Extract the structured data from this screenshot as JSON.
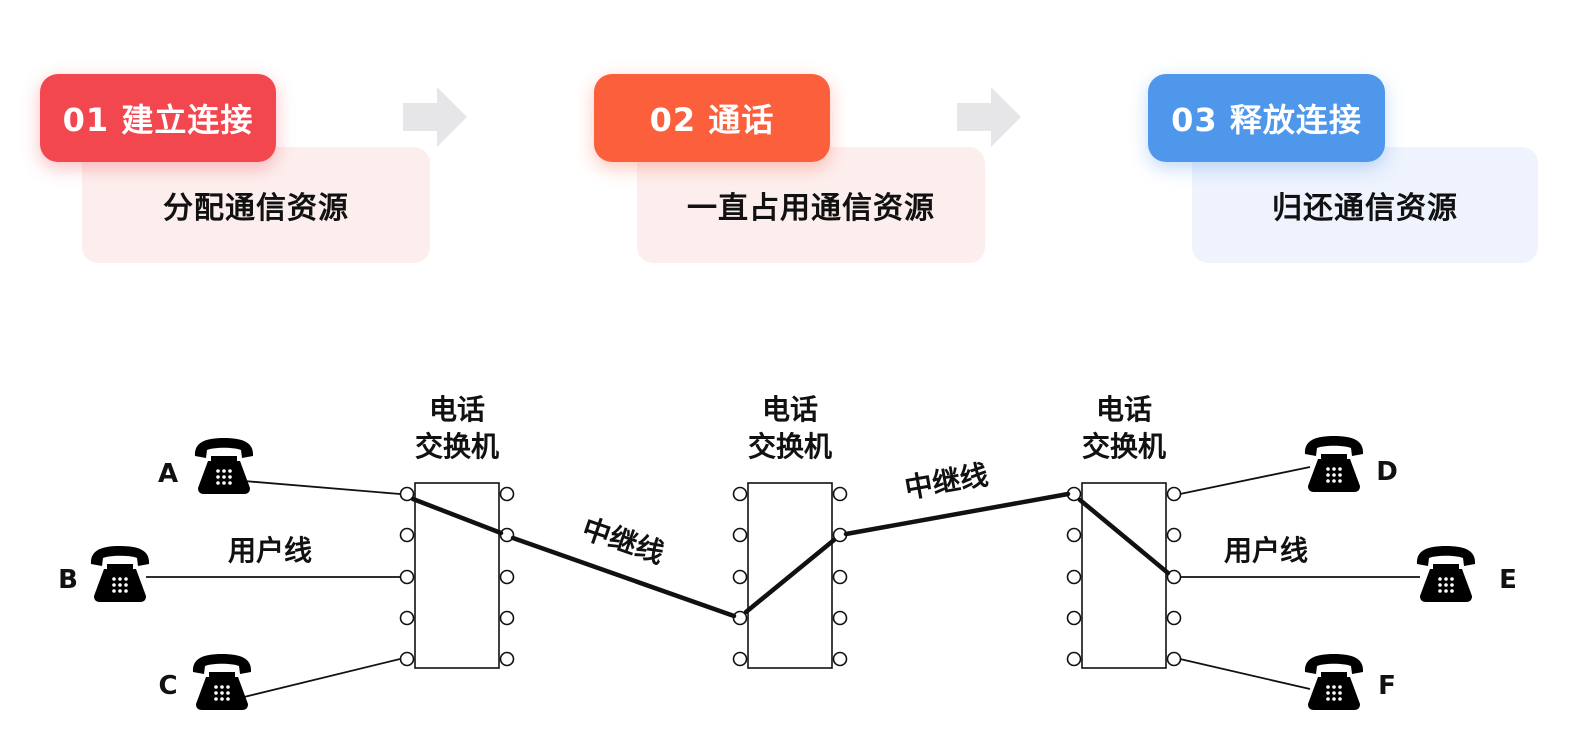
{
  "steps": [
    {
      "title": "01 建立连接",
      "desc": "分配通信资源",
      "color": "#f2474f",
      "desc_bg": "#fdeeee"
    },
    {
      "title": "02 通话",
      "desc": "一直占用通信资源",
      "color": "#fb5f3c",
      "desc_bg": "#fdeeee"
    },
    {
      "title": "03 释放连接",
      "desc": "归还通信资源",
      "color": "#4f97ea",
      "desc_bg": "#eef3fd"
    }
  ],
  "diagram": {
    "switch_label_line1": "电话",
    "switch_label_line2": "交换机",
    "trunk_label": "中继线",
    "user_line_label": "用户线",
    "phones_left": [
      "A",
      "B",
      "C"
    ],
    "phones_right": [
      "D",
      "E",
      "F"
    ]
  }
}
